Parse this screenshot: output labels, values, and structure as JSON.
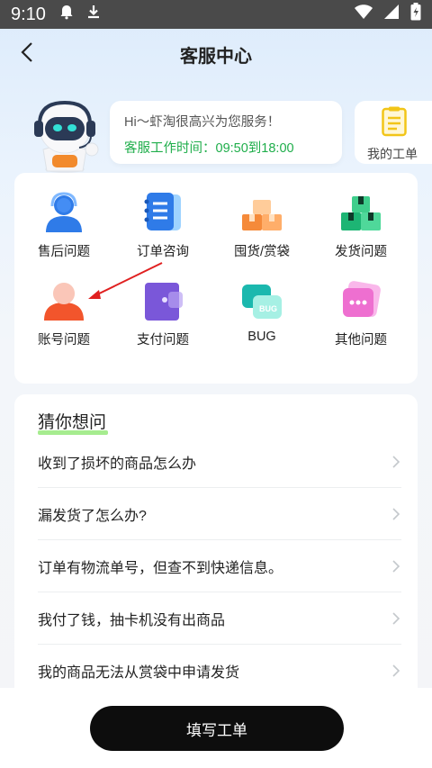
{
  "status_bar": {
    "time": "9:10"
  },
  "header": {
    "title": "客服中心"
  },
  "greeting": {
    "line1": "Hi～虾淘很高兴为您服务！",
    "line2": "客服工作时间：09:50到18:00"
  },
  "ticket": {
    "label": "我的工单"
  },
  "categories": [
    {
      "label": "售后问题",
      "icon": "headset-person-icon"
    },
    {
      "label": "订单咨询",
      "icon": "notebook-icon"
    },
    {
      "label": "囤货/赏袋",
      "icon": "boxes-icon"
    },
    {
      "label": "发货问题",
      "icon": "shipping-box-icon"
    },
    {
      "label": "账号问题",
      "icon": "user-avatar-icon"
    },
    {
      "label": "支付问题",
      "icon": "wallet-icon"
    },
    {
      "label": "BUG",
      "icon": "bug-chat-icon"
    },
    {
      "label": "其他问题",
      "icon": "more-chat-icon"
    }
  ],
  "faq": {
    "title": "猜你想问",
    "items": [
      "收到了损坏的商品怎么办",
      "漏发货了怎么办?",
      "订单有物流单号，但查不到快递信息。",
      "我付了钱，抽卡机没有出商品",
      "我的商品无法从赏袋中申请发货"
    ]
  },
  "submit": {
    "label": "填写工单"
  },
  "colors": {
    "accent_green": "#1fae4b",
    "button_black": "#0d0d0d"
  }
}
